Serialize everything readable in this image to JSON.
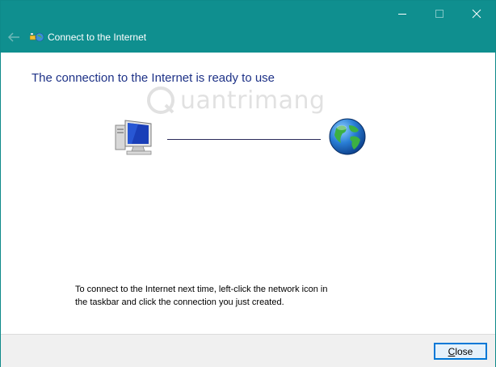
{
  "window": {
    "title": "Connect to the Internet",
    "caption_buttons": [
      "minimize",
      "maximize",
      "close"
    ]
  },
  "content": {
    "heading": "The connection to the Internet is ready to use",
    "watermark": "uantrimang",
    "instructions_line1": "To connect to the Internet next time, left-click the network icon in",
    "instructions_line2": "the taskbar and click the connection you just created."
  },
  "footer": {
    "close_label_accel": "C",
    "close_label_rest": "lose"
  },
  "icons": {
    "back": "back-arrow-icon",
    "wizard": "network-wizard-icon",
    "computer": "computer-icon",
    "globe": "globe-icon"
  },
  "colors": {
    "titlebar": "#0f8f8f",
    "heading": "#1e3287",
    "button_border": "#0078d7"
  }
}
